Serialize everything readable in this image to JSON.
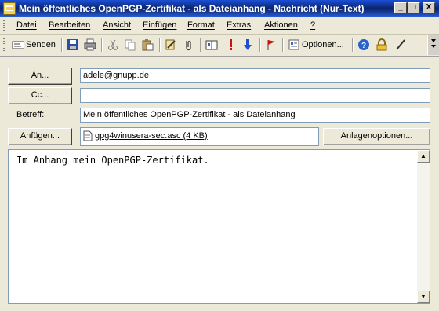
{
  "window": {
    "title": "Mein öffentliches OpenPGP-Zertifikat - als Dateianhang - Nachricht (Nur-Text)",
    "minimize_glyph": "_",
    "maximize_glyph": "□",
    "close_glyph": "X"
  },
  "menu": {
    "items": [
      "Datei",
      "Bearbeiten",
      "Ansicht",
      "Einfügen",
      "Format",
      "Extras",
      "Aktionen",
      "?"
    ]
  },
  "toolbar": {
    "send_label": "Senden",
    "options_label": "Optionen..."
  },
  "header": {
    "to_label": "An...",
    "to_value": "adele@gnupp.de",
    "cc_label": "Cc...",
    "cc_value": "",
    "subject_label": "Betreff:",
    "subject_value": "Mein öffentliches OpenPGP-Zertifikat - als Dateianhang",
    "attach_label": "Anfügen...",
    "attachment_name": "gpg4winusera-sec.asc (4 KB)",
    "attachment_options_label": "Anlagenoptionen..."
  },
  "body": {
    "text": "Im Anhang mein OpenPGP-Zertifikat."
  },
  "colors": {
    "titlebar": "#0a246a",
    "window_bg": "#ece9d8",
    "field_border": "#7f9db9"
  }
}
